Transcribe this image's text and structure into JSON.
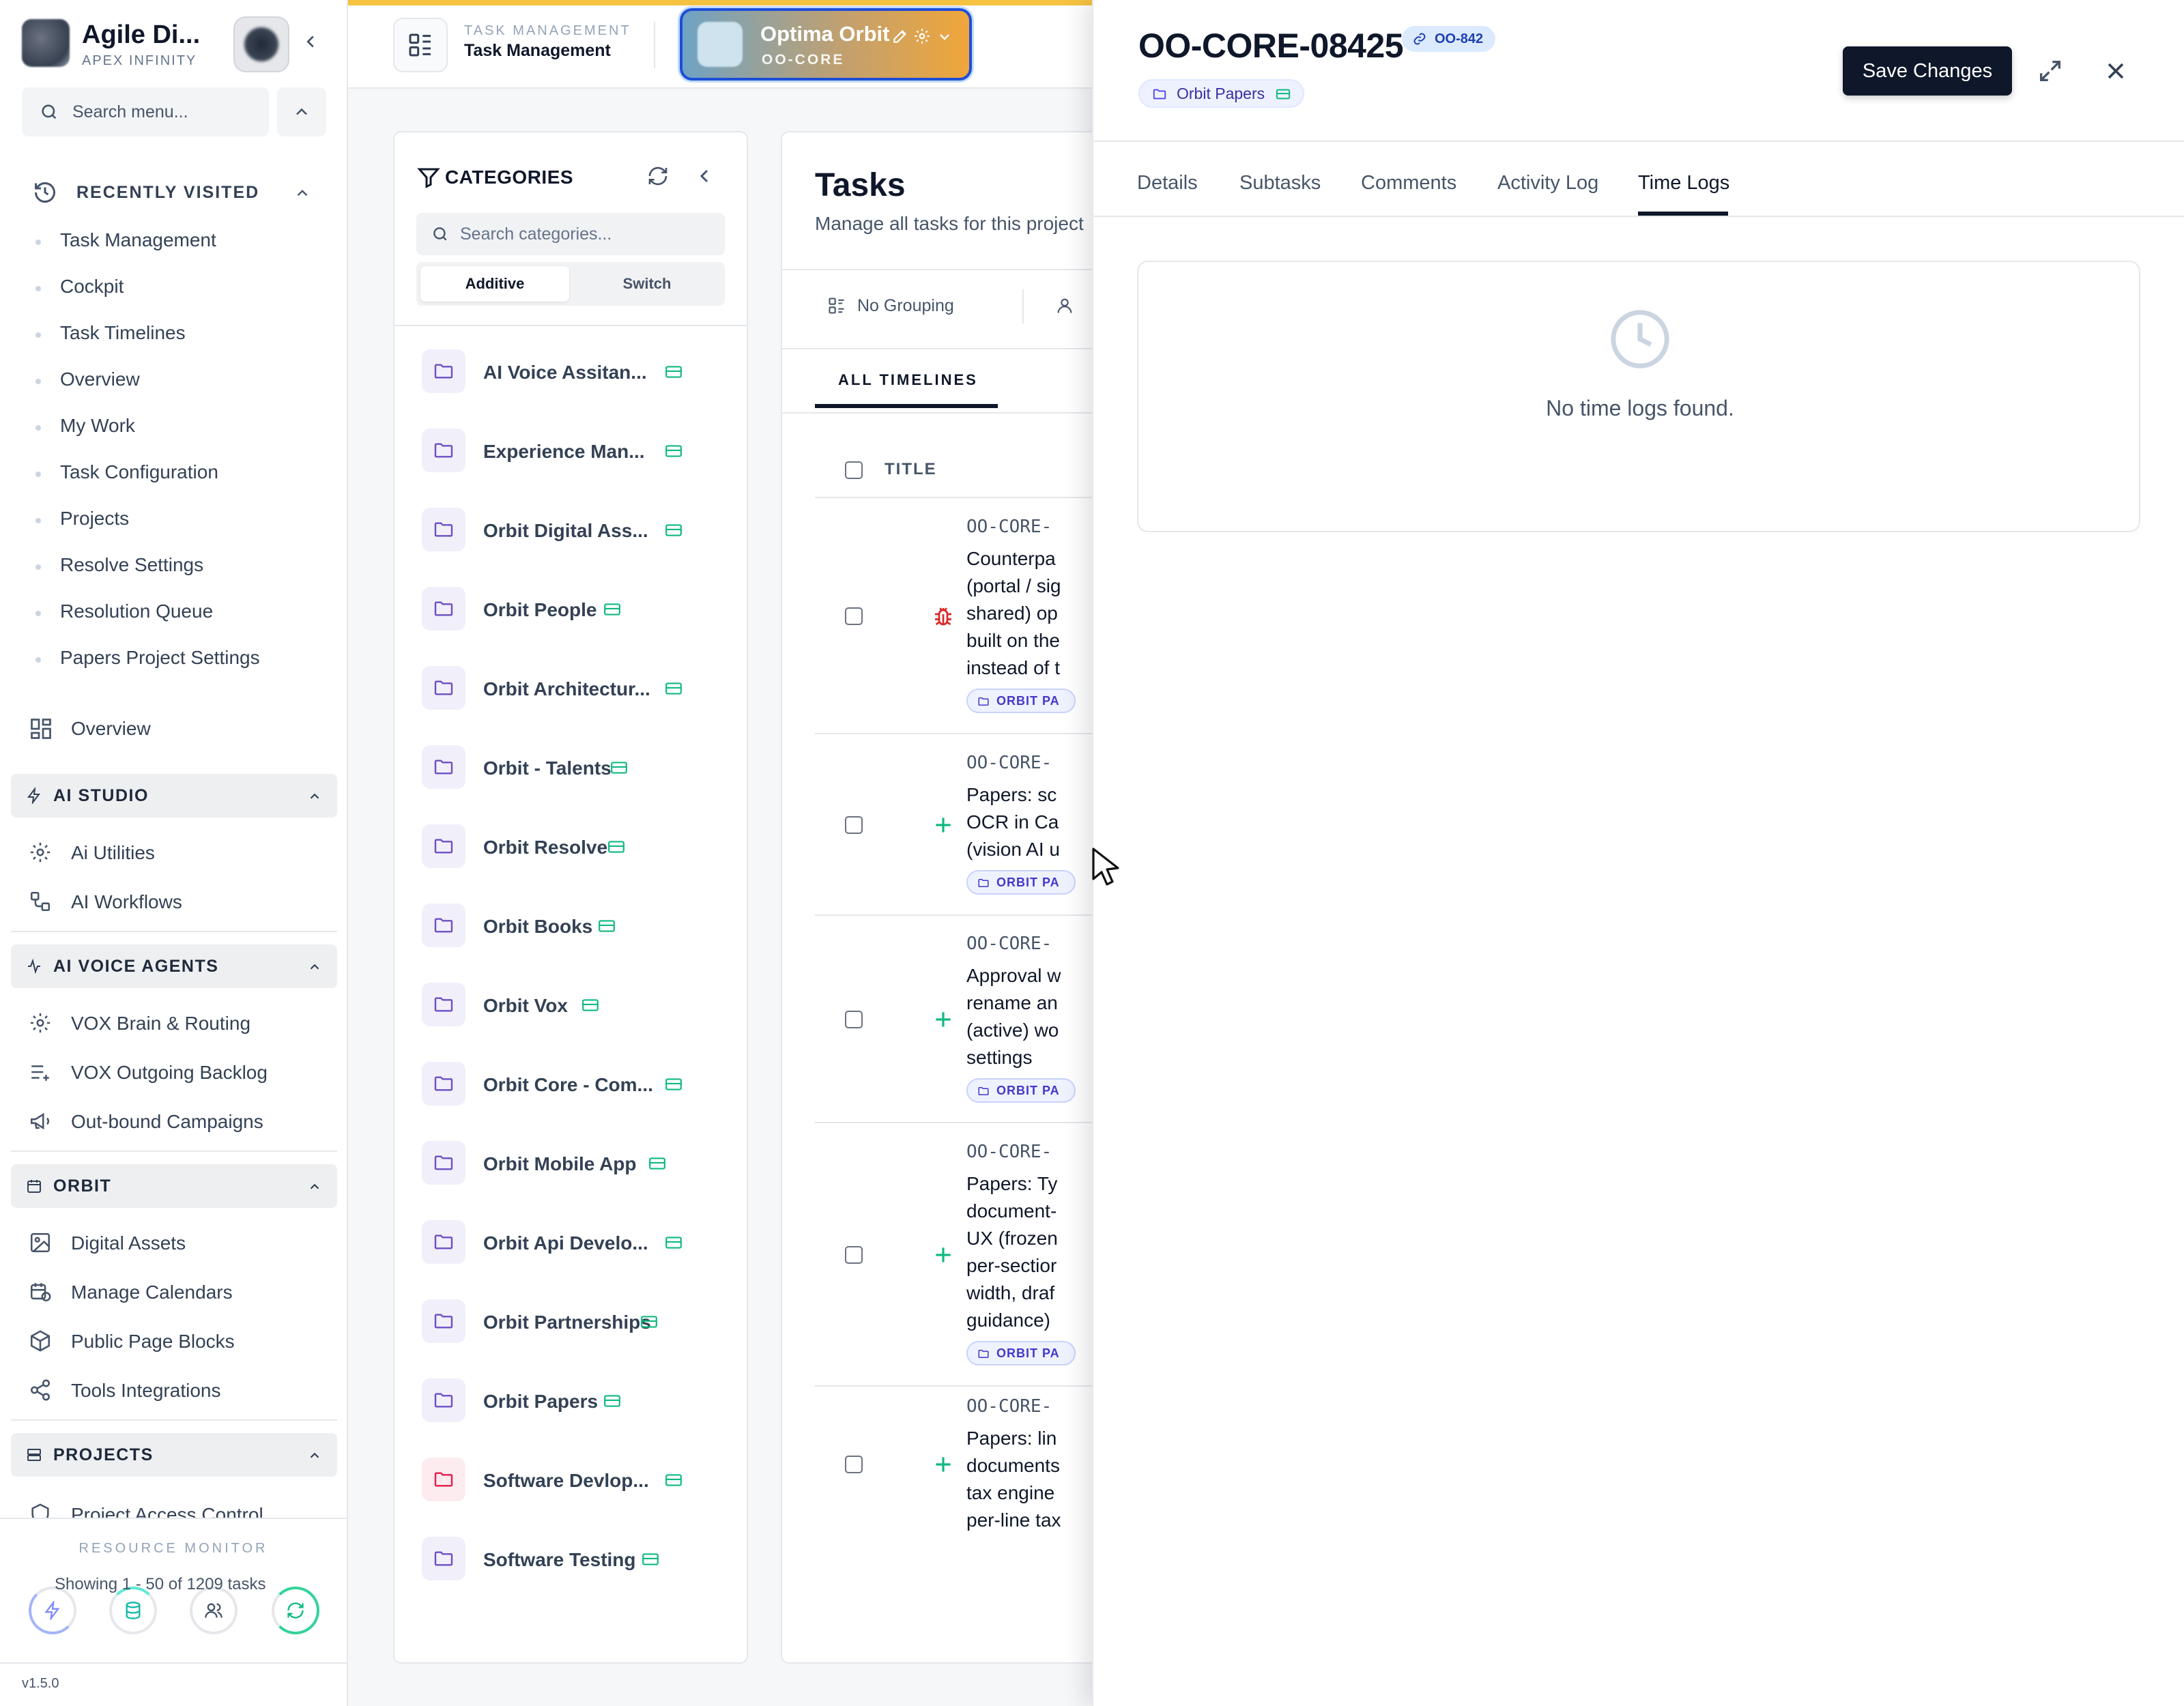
{
  "sidebar": {
    "brand_title": "Agile Di...",
    "brand_subtitle": "APEX INFINITY",
    "search_placeholder": "Search menu...",
    "recently_visited_label": "RECENTLY VISITED",
    "recent_items": [
      "Task Management",
      "Cockpit",
      "Task Timelines",
      "Overview",
      "My Work",
      "Task Configuration",
      "Projects",
      "Resolve Settings",
      "Resolution Queue",
      "Papers Project Settings"
    ],
    "overview_label": "Overview",
    "sections": [
      {
        "title": "AI STUDIO",
        "items": [
          {
            "label": "Ai Utilities",
            "icon": "gear-icon"
          },
          {
            "label": "AI Workflows",
            "icon": "workflow-icon"
          }
        ]
      },
      {
        "title": "AI VOICE AGENTS",
        "items": [
          {
            "label": "VOX Brain & Routing",
            "icon": "gear-icon"
          },
          {
            "label": "VOX Outgoing Backlog",
            "icon": "list-plus-icon"
          },
          {
            "label": "Out-bound Campaigns",
            "icon": "megaphone-icon"
          }
        ]
      },
      {
        "title": "ORBIT",
        "items": [
          {
            "label": "Digital Assets",
            "icon": "image-icon"
          },
          {
            "label": "Manage Calendars",
            "icon": "calendar-icon"
          },
          {
            "label": "Public Page Blocks",
            "icon": "box-icon"
          },
          {
            "label": "Tools Integrations",
            "icon": "share-icon"
          }
        ]
      },
      {
        "title": "PROJECTS",
        "items": [
          {
            "label": "Project Access Control",
            "icon": "shield-icon"
          }
        ]
      }
    ],
    "resource_monitor_label": "RESOURCE MONITOR",
    "version": "v1.5.0"
  },
  "topbar": {
    "module_overline": "TASK MANAGEMENT",
    "module_title": "Task Management",
    "project_name": "Optima Orbit",
    "project_code": "OO-CORE"
  },
  "categories": {
    "title": "CATEGORIES",
    "search_placeholder": "Search categories...",
    "mode_additive": "Additive",
    "mode_switch": "Switch",
    "items": [
      "AI Voice Assitan...",
      "Experience Man...",
      "Orbit Digital Ass...",
      "Orbit People",
      "Orbit Architectur...",
      "Orbit - Talents",
      "Orbit Resolve",
      "Orbit Books",
      "Orbit Vox",
      "Orbit Core - Com...",
      "Orbit Mobile App",
      "Orbit Api Develo...",
      "Orbit Partnerships",
      "Orbit Papers",
      "Software Devlop...",
      "Software Testing"
    ]
  },
  "tasks": {
    "title": "Tasks",
    "subtitle": "Manage all tasks for this project",
    "grouping": "No Grouping",
    "tab_all": "ALL TIMELINES",
    "col_title": "TITLE",
    "rows": [
      {
        "code": "OO-CORE-",
        "lines": [
          "Counterpa",
          "(portal / sig",
          "shared) op",
          "built on the",
          "instead of t"
        ],
        "chip": "ORBIT PA",
        "type": "bug"
      },
      {
        "code": "OO-CORE-",
        "lines": [
          "Papers: sc",
          "OCR in Ca",
          "(vision AI u"
        ],
        "chip": "ORBIT PA",
        "type": "feature"
      },
      {
        "code": "OO-CORE-",
        "lines": [
          "Approval w",
          "rename an",
          "(active) wo",
          "settings"
        ],
        "chip": "ORBIT PA",
        "type": "feature"
      },
      {
        "code": "OO-CORE-",
        "lines": [
          "Papers: Ty",
          "document-",
          "UX (frozen",
          "per-sectior",
          "width, draf",
          "guidance)"
        ],
        "chip": "ORBIT PA",
        "type": "feature"
      },
      {
        "code": "OO-CORE-",
        "lines": [
          "Papers: lin",
          "documents",
          "tax engine",
          "per-line tax"
        ],
        "chip": "",
        "type": "feature"
      }
    ],
    "footer": "Showing 1 - 50 of 1209 tasks"
  },
  "drawer": {
    "task_id": "OO-CORE-08425",
    "linked_ref": "OO-842",
    "category": "Orbit Papers",
    "save_label": "Save Changes",
    "tabs": [
      "Details",
      "Subtasks",
      "Comments",
      "Activity Log",
      "Time Logs"
    ],
    "active_tab": "Time Logs",
    "empty_message": "No time logs found."
  },
  "colors": {
    "accent": "#0f172a",
    "project_gradient_start": "#6fa3c4",
    "project_gradient_end": "#f0a63a",
    "chip_text": "#4338ca",
    "progress_strip": "#f5c242"
  }
}
